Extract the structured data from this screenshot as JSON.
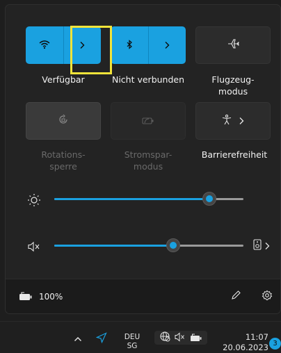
{
  "quick_settings": {
    "wifi": {
      "label": "Verfügbar",
      "state": "on"
    },
    "bluetooth": {
      "label": "Nicht verbunden",
      "state": "on"
    },
    "airplane": {
      "label_line1": "Flugzeug-",
      "label_line2": "modus",
      "state": "off"
    },
    "rotation_lock": {
      "label_line1": "Rotations-",
      "label_line2": "sperre",
      "state": "disabled"
    },
    "battery_saver": {
      "label_line1": "Stromspar-",
      "label_line2": "modus",
      "state": "disabled"
    },
    "accessibility": {
      "label": "Barrierefreiheit",
      "state": "off"
    }
  },
  "brightness": {
    "value_percent": 82
  },
  "volume": {
    "value_percent": 63,
    "muted": true
  },
  "footer": {
    "battery_text": "100%"
  },
  "taskbar": {
    "language_line1": "DEU",
    "language_line2": "SG",
    "time": "11:07",
    "date": "20.06.2023",
    "notification_count": "3"
  },
  "colors": {
    "accent": "#1aa1e0",
    "highlight_box": "#f2e43a",
    "panel_bg": "#232323"
  }
}
